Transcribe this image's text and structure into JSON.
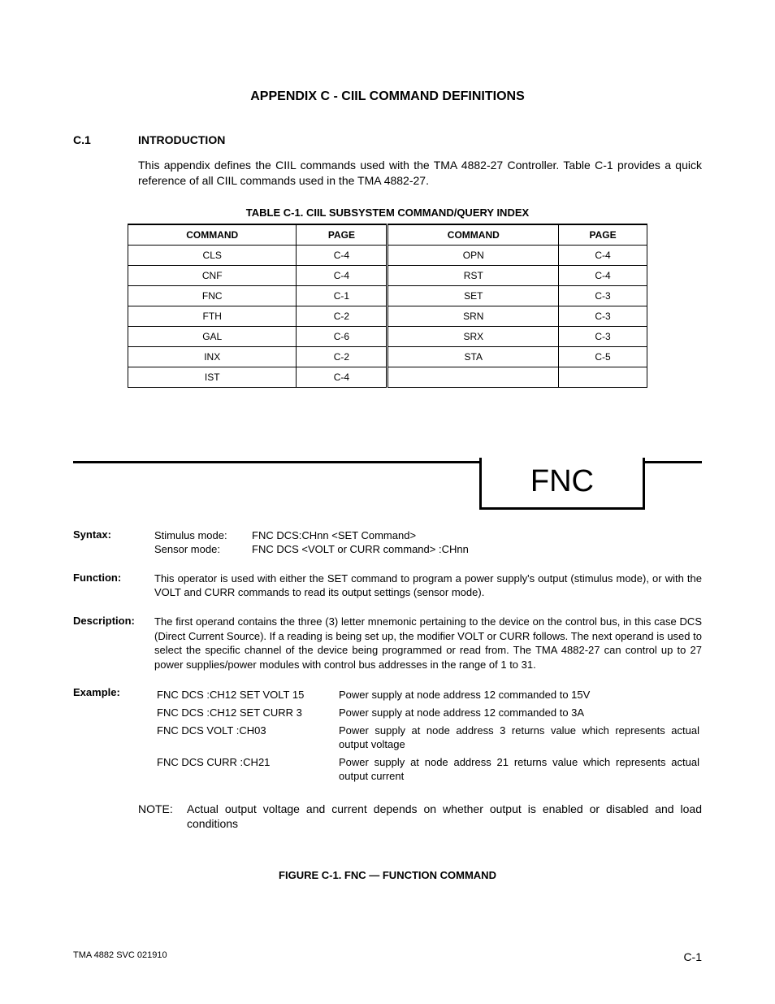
{
  "title": "APPENDIX C  -  CIIL COMMAND DEFINITIONS",
  "section": {
    "num": "C.1",
    "heading": "INTRODUCTION"
  },
  "intro": "This appendix defines the CIIL commands used with the TMA 4882-27 Controller. Table C-1 provides a quick reference of all CIIL commands used in the TMA 4882-27.",
  "table": {
    "caption": "TABLE C-1.  CIIL SUBSYSTEM COMMAND/QUERY INDEX",
    "headers": [
      "COMMAND",
      "PAGE",
      "COMMAND",
      "PAGE"
    ],
    "rows": [
      [
        "CLS",
        "C-4",
        "OPN",
        "C-4"
      ],
      [
        "CNF",
        "C-4",
        "RST",
        "C-4"
      ],
      [
        "FNC",
        "C-1",
        "SET",
        "C-3"
      ],
      [
        "FTH",
        "C-2",
        "SRN",
        "C-3"
      ],
      [
        "GAL",
        "C-6",
        "SRX",
        "C-3"
      ],
      [
        "INX",
        "C-2",
        "STA",
        "C-5"
      ],
      [
        "IST",
        "C-4",
        "",
        ""
      ]
    ]
  },
  "command_box": "FNC",
  "syntax": {
    "label": "Syntax:",
    "lines": [
      {
        "mode": "Stimulus mode:",
        "text": "FNC DCS:CHnn <SET Command>"
      },
      {
        "mode": "Sensor mode:",
        "text": "FNC DCS <VOLT or CURR command> :CHnn"
      }
    ]
  },
  "function": {
    "label": "Function:",
    "text": "This operator is used with either the SET command to program a power supply's output (stimulus mode), or with the VOLT and CURR commands to read its output settings (sensor mode)."
  },
  "description": {
    "label": "Description:",
    "text": "The first operand contains the three (3) letter mnemonic pertaining to the device on the control bus, in this case DCS (Direct Current Source). If a reading is being set up, the modifier VOLT or CURR follows. The next operand is used to select the specific channel of the device being programmed or read from. The TMA 4882-27 can control up to 27 power supplies/power modules with control bus addresses in the range of 1 to 31."
  },
  "example": {
    "label": "Example:",
    "rows": [
      {
        "cmd": "FNC DCS :CH12 SET VOLT 15",
        "desc": "Power supply at node address 12 commanded to 15V"
      },
      {
        "cmd": "FNC DCS :CH12 SET CURR 3",
        "desc": "Power supply at node address 12 commanded to 3A"
      },
      {
        "cmd": "FNC DCS VOLT :CH03",
        "desc": "Power supply at node address 3 returns value which represents actual output voltage"
      },
      {
        "cmd": "FNC DCS CURR :CH21",
        "desc": "Power supply at node address 21 returns value which represents actual output current"
      }
    ]
  },
  "note": {
    "label": "NOTE:",
    "text": "Actual output voltage and current depends on whether output is enabled or disabled and load conditions"
  },
  "figure_caption": "FIGURE C-1.    FNC — FUNCTION COMMAND",
  "footer": {
    "left": "TMA 4882 SVC 021910",
    "right": "C-1"
  }
}
